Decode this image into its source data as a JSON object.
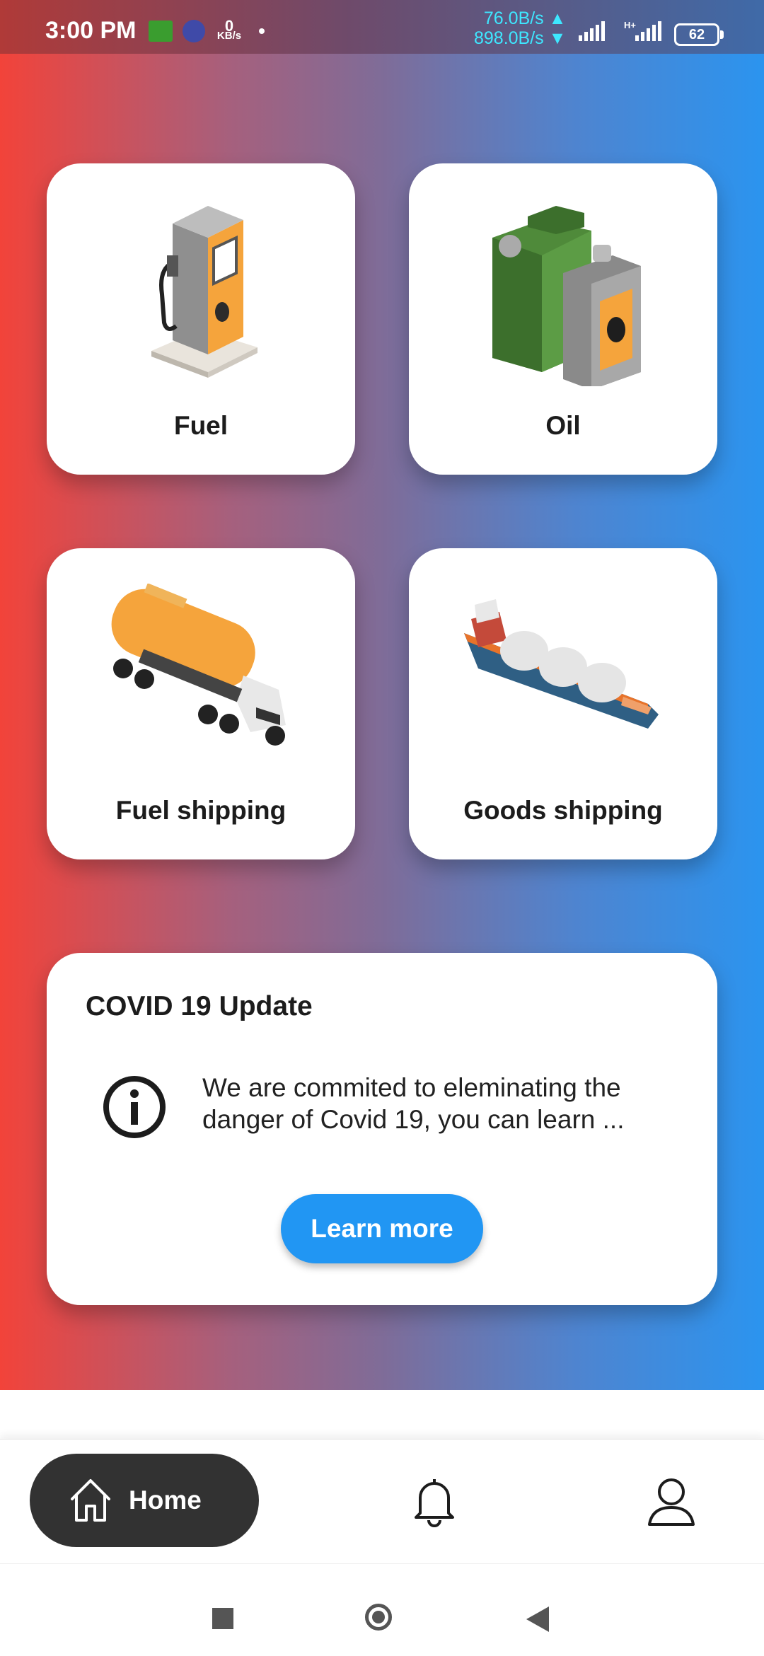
{
  "status_bar": {
    "time": "3:00 PM",
    "net_speed_value": "0",
    "net_speed_unit": "KB/s",
    "upload_speed": "76.0B/s ▲",
    "download_speed": "898.0B/s ▼",
    "network_type": "H+",
    "battery": "62"
  },
  "tiles": [
    {
      "label": "Fuel",
      "icon": "fuel-pump-icon"
    },
    {
      "label": "Oil",
      "icon": "oil-can-icon"
    },
    {
      "label": "Fuel shipping",
      "icon": "tanker-truck-icon"
    },
    {
      "label": "Goods shipping",
      "icon": "cargo-ship-icon"
    }
  ],
  "covid_card": {
    "title": "COVID 19 Update",
    "message": "We are commited to eleminating the danger of Covid 19, you can learn ...",
    "button_label": "Learn more",
    "icon": "info-icon"
  },
  "bottom_nav": {
    "home_label": "Home",
    "active": "home",
    "items": [
      "home-icon",
      "bell-icon",
      "user-icon"
    ]
  },
  "colors": {
    "gradient_start": "#f2433a",
    "gradient_end": "#2b94ef",
    "button": "#2196f3",
    "nav_active": "#323232"
  }
}
